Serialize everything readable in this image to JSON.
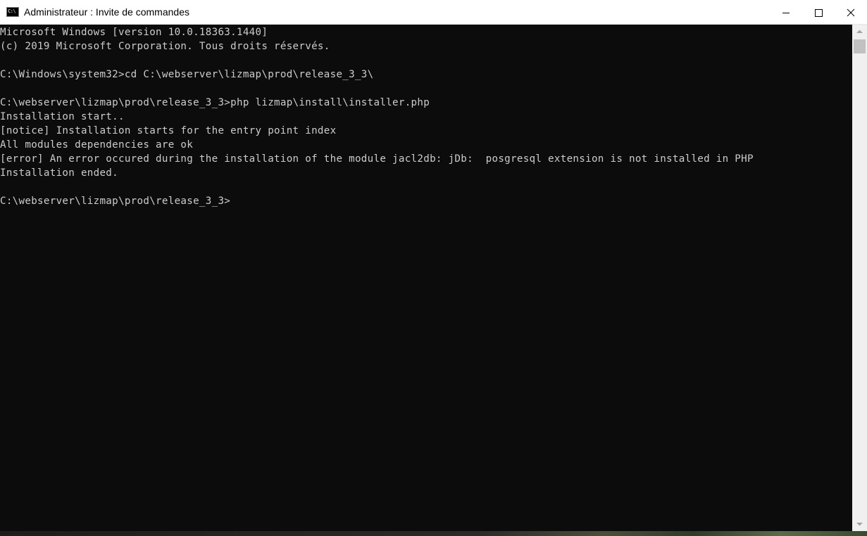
{
  "window": {
    "title": "Administrateur : Invite de commandes",
    "icon": "cmd-icon",
    "icon_glyph": "C:\\",
    "controls": [
      "minimize-icon",
      "maximize-icon",
      "close-icon"
    ]
  },
  "console": {
    "foreground": "#cccccc",
    "background": "#0c0c0c",
    "lines": [
      "Microsoft Windows [version 10.0.18363.1440]",
      "(c) 2019 Microsoft Corporation. Tous droits réservés.",
      "",
      "C:\\Windows\\system32>cd C:\\webserver\\lizmap\\prod\\release_3_3\\",
      "",
      "C:\\webserver\\lizmap\\prod\\release_3_3>php lizmap\\install\\installer.php",
      "Installation start..",
      "[notice] Installation starts for the entry point index",
      "All modules dependencies are ok",
      "[error] An error occured during the installation of the module jacl2db: jDb:  posgresql extension is not installed in PHP",
      "Installation ended.",
      "",
      "C:\\webserver\\lizmap\\prod\\release_3_3>"
    ]
  }
}
